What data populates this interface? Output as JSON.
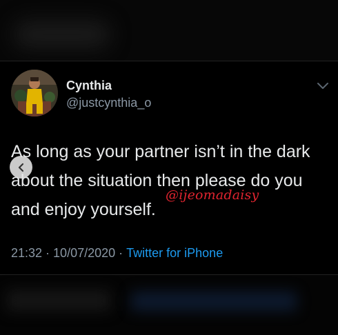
{
  "tweet": {
    "display_name": "Cynthia",
    "handle": "@justcynthia_o",
    "text": "As long as your partner isn’t in the dark about the situation then please do you and enjoy yourself.",
    "time": "21:32",
    "separator": "·",
    "date": "10/07/2020",
    "source": "Twitter for iPhone"
  },
  "watermark": "@ijeomadaisy",
  "colors": {
    "background": "#000000",
    "text_primary": "#e7e9ea",
    "text_secondary": "#8b98a5",
    "link": "#1d9bf0",
    "watermark": "#e0242f"
  },
  "icons": {
    "more": "chevron-down-icon",
    "previous": "chevron-left-icon"
  }
}
